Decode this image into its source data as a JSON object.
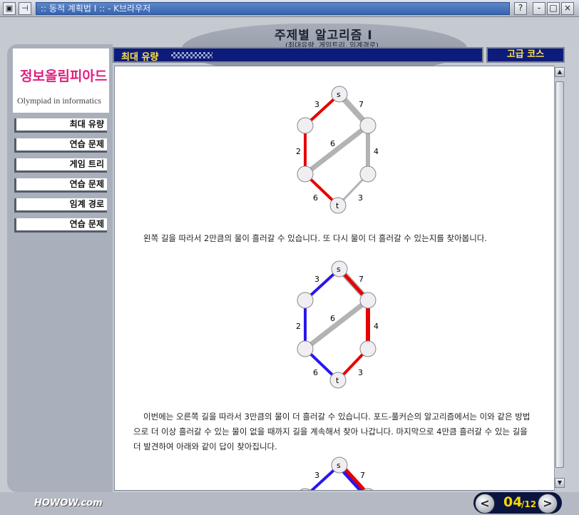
{
  "window": {
    "title": ":: 동적 계획법 I :: - K브라우저",
    "buttons": {
      "help": "?",
      "minimize": "-",
      "maximize": "□",
      "close": "×"
    }
  },
  "banner": {
    "title": "주제별 알고리즘 I",
    "subtitle": "(최대유량, 게임트리, 임계경로)"
  },
  "logo": {
    "korean": "정보올림피아드",
    "english": "Olympiad in informatics"
  },
  "sidebar": {
    "items": [
      {
        "label": "최대 유량"
      },
      {
        "label": "연습 문제"
      },
      {
        "label": "게임 트리"
      },
      {
        "label": "연습 문제"
      },
      {
        "label": "임계 경로"
      },
      {
        "label": "연습 문제"
      }
    ]
  },
  "header": {
    "section": "최대 유량",
    "course": "고급 코스"
  },
  "graphs": {
    "labels": {
      "s": "s",
      "t": "t",
      "e_s_l1": "3",
      "e_s_r1": "7",
      "e_l1_l2": "2",
      "e_r1_l2": "6",
      "e_r1_r2": "4",
      "e_l2_t": "6",
      "e_r2_t": "3"
    },
    "colors": {
      "gray": "#b3b3b3",
      "red": "#e60000",
      "blue": "#2a16ee"
    }
  },
  "content": {
    "para1": "왼쪽 길을 따라서 2만큼의 물이 흘러갈 수 있습니다. 또 다시 물이 더 흘러갈 수 있는지를 찾아봅니다.",
    "para2": "이번에는 오른쪽 길을 따라서 3만큼의 물이 더 흘러갈 수 있습니다. 포드-풀커슨의 알고리즘에서는 이와 같은 방법으로 더 이상 흘러갈 수 있는 물이 없을 때까지 길을 계속해서 찾아 나갑니다. 마지막으로 4만큼 흘러갈 수 있는 길을 더 발견하여 아래와 같이 답이 찾아집니다."
  },
  "footer": {
    "brand": "HOWOW.com",
    "page_current": "04",
    "page_total": "/12",
    "prev": "<",
    "next": ">"
  }
}
